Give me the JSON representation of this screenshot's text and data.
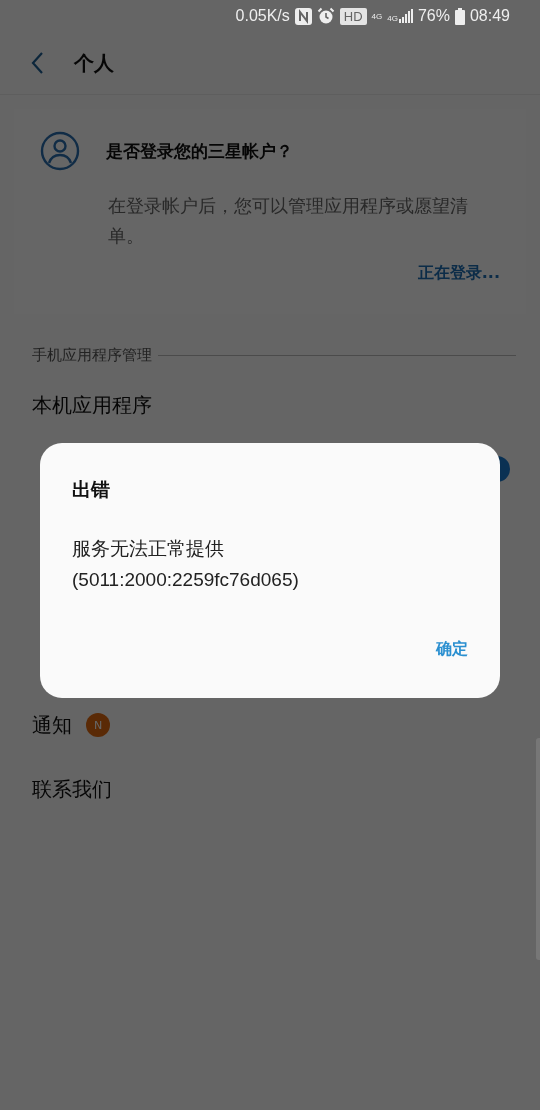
{
  "status_bar": {
    "speed": "0.05K/s",
    "hd": "HD",
    "data_label": "4G",
    "signal_label": "4G",
    "battery": "76%",
    "time": "08:49"
  },
  "header": {
    "title": "个人"
  },
  "account_card": {
    "title": "是否登录您的三星帐户？",
    "description": "在登录帐户后，您可以管理应用程序或愿望清单。",
    "action": "正在登录..."
  },
  "section": {
    "title": "手机应用程序管理"
  },
  "menu_items": [
    {
      "kind": "item",
      "label": "本机应用程序"
    },
    {
      "kind": "covered",
      "badge": true
    },
    {
      "kind": "covered"
    },
    {
      "kind": "covered"
    },
    {
      "kind": "covered"
    },
    {
      "kind": "item",
      "label": "通知",
      "badge_text": "N"
    },
    {
      "kind": "item",
      "label": "联系我们"
    }
  ],
  "dialog": {
    "title": "出错",
    "message": "服务无法正常提供",
    "code": "(5011:2000:2259fc76d065)",
    "button": "确定"
  }
}
